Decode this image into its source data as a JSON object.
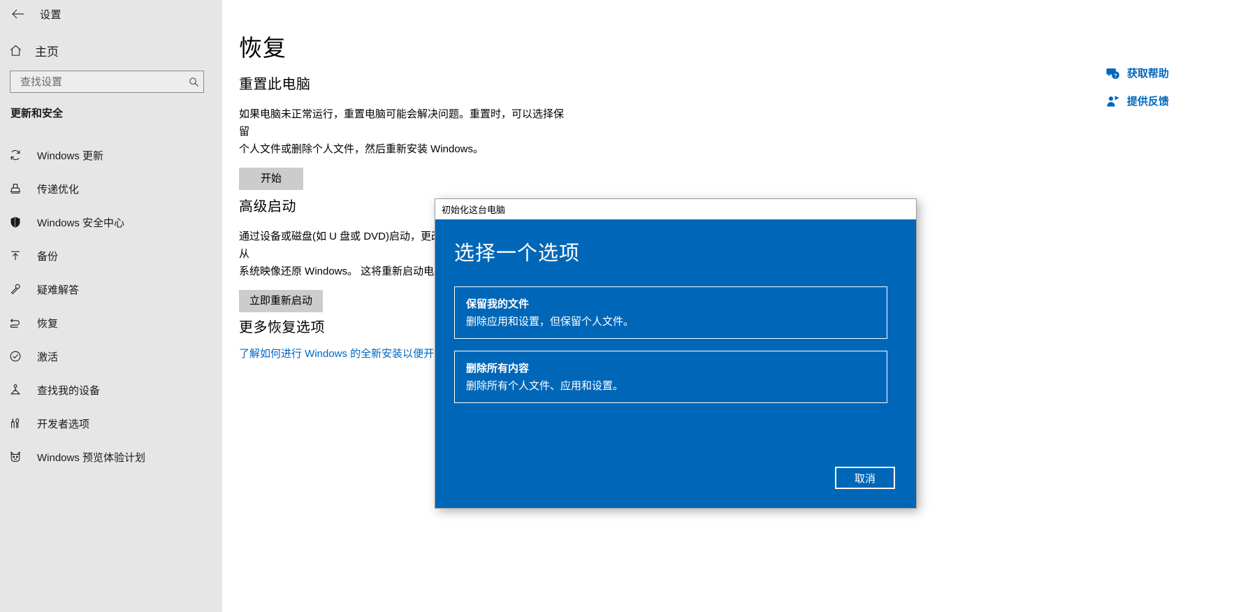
{
  "window": {
    "app_title": "设置",
    "back_icon": "back-arrow-icon"
  },
  "sidebar": {
    "home_label": "主页",
    "home_icon": "home-icon",
    "search": {
      "placeholder": "查找设置",
      "value": "",
      "icon": "search-icon"
    },
    "group_title": "更新和安全",
    "items": [
      {
        "label": "Windows 更新",
        "icon": "sync-refresh-icon"
      },
      {
        "label": "传递优化",
        "icon": "delivery-optimization-icon"
      },
      {
        "label": "Windows 安全中心",
        "icon": "shield-icon"
      },
      {
        "label": "备份",
        "icon": "upload-arrow-icon"
      },
      {
        "label": "疑难解答",
        "icon": "wrench-icon"
      },
      {
        "label": "恢复",
        "icon": "recovery-icon"
      },
      {
        "label": "激活",
        "icon": "check-circle-icon"
      },
      {
        "label": "查找我的设备",
        "icon": "find-my-device-icon"
      },
      {
        "label": "开发者选项",
        "icon": "developer-tools-icon"
      },
      {
        "label": "Windows 预览体验计划",
        "icon": "insider-bug-icon"
      }
    ]
  },
  "main": {
    "page_title": "恢复",
    "sections": [
      {
        "heading": "重置此电脑",
        "body_line1": "如果电脑未正常运行，重置电脑可能会解决问题。重置时，可以选择保留",
        "body_line2": "个人文件或删除个人文件，然后重新安装 Windows。",
        "button": "开始"
      },
      {
        "heading": "高级启动",
        "body_line1": "通过设备或磁盘(如 U 盘或 DVD)启动，更改 Windows 启动设置，或者从",
        "body_line2": "系统映像还原 Windows。 这将重新启动电脑。",
        "button": "立即重新启动"
      },
      {
        "heading": "更多恢复选项",
        "link": "了解如何进行 Windows 的全新安装以便开始"
      }
    ],
    "help_panel": {
      "get_help": {
        "label": "获取帮助",
        "icon": "question-chat-icon"
      },
      "give_feedback": {
        "label": "提供反馈",
        "icon": "feedback-person-icon"
      }
    }
  },
  "dialog": {
    "titlebar": "初始化这台电脑",
    "heading": "选择一个选项",
    "options": [
      {
        "title": "保留我的文件",
        "desc": "删除应用和设置，但保留个人文件。"
      },
      {
        "title": "删除所有内容",
        "desc": "删除所有个人文件、应用和设置。"
      }
    ],
    "cancel_label": "取消",
    "accent_color": "#0067b8"
  }
}
